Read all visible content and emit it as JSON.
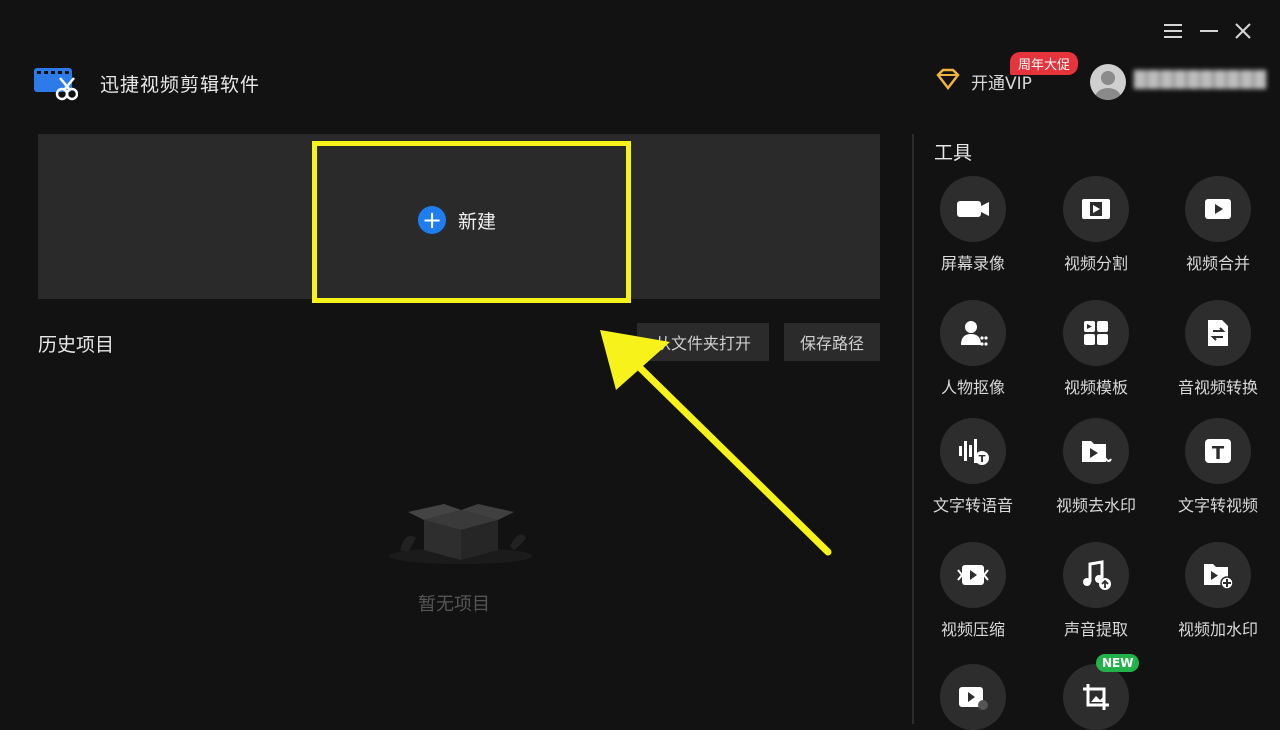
{
  "app": {
    "title": "迅捷视频剪辑软件"
  },
  "header": {
    "vip_label": "开通VIP",
    "promo_badge": "周年大促",
    "username": "██████████"
  },
  "main": {
    "new_label": "新建",
    "history_title": "历史项目",
    "open_folder_label": "从文件夹打开",
    "save_path_label": "保存路径",
    "empty_text": "暂无项目"
  },
  "tools": {
    "title": "工具",
    "items": [
      {
        "label": "屏幕录像",
        "icon": "camera-icon"
      },
      {
        "label": "视频分割",
        "icon": "film-split-icon"
      },
      {
        "label": "视频合并",
        "icon": "video-merge-icon"
      },
      {
        "label": "人物抠像",
        "icon": "person-cutout-icon"
      },
      {
        "label": "视频模板",
        "icon": "template-icon"
      },
      {
        "label": "音视频转换",
        "icon": "convert-icon"
      },
      {
        "label": "文字转语音",
        "icon": "text-to-speech-icon"
      },
      {
        "label": "视频去水印",
        "icon": "remove-watermark-icon"
      },
      {
        "label": "文字转视频",
        "icon": "text-to-video-icon"
      },
      {
        "label": "视频压缩",
        "icon": "compress-icon"
      },
      {
        "label": "声音提取",
        "icon": "audio-extract-icon"
      },
      {
        "label": "视频加水印",
        "icon": "add-watermark-icon"
      }
    ],
    "new_badge": "NEW"
  },
  "colors": {
    "accent_blue": "#1f7df0",
    "highlight_yellow": "#f7f31a",
    "promo_red": "#e5343b",
    "badge_green": "#21b24a"
  }
}
